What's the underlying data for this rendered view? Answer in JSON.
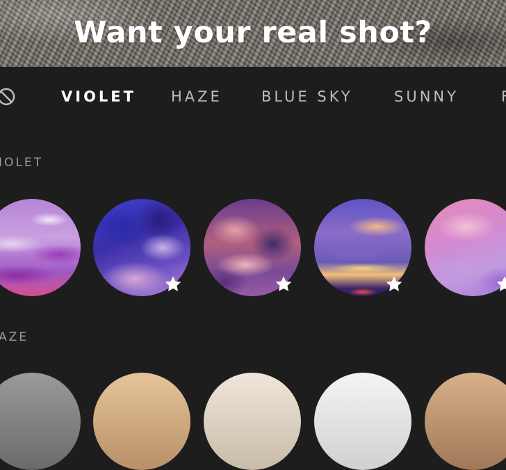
{
  "banner": {
    "title": "Want your real shot?"
  },
  "tabs": {
    "none_icon": "no-filter-icon",
    "items": [
      {
        "label": "VIOLET",
        "active": true
      },
      {
        "label": "HAZE",
        "active": false
      },
      {
        "label": "BLUE SKY",
        "active": false
      },
      {
        "label": "SUNNY",
        "active": false
      },
      {
        "label": "F",
        "active": false
      }
    ]
  },
  "sections": [
    {
      "label": "IOLET",
      "thumbnails": [
        {
          "name": "violet-1",
          "starred": false
        },
        {
          "name": "violet-2",
          "starred": true
        },
        {
          "name": "violet-3",
          "starred": true
        },
        {
          "name": "violet-4",
          "starred": true
        },
        {
          "name": "violet-5",
          "starred": true
        }
      ]
    },
    {
      "label": "AZE",
      "thumbnails": [
        {
          "name": "haze-1"
        },
        {
          "name": "haze-2"
        },
        {
          "name": "haze-3"
        },
        {
          "name": "haze-4"
        },
        {
          "name": "haze-5"
        }
      ]
    }
  ],
  "colors": {
    "background": "#1e1d1e",
    "tab_active": "#ffffff",
    "tab_inactive": "#bdbbbb",
    "section_label": "#9c9a9a"
  }
}
